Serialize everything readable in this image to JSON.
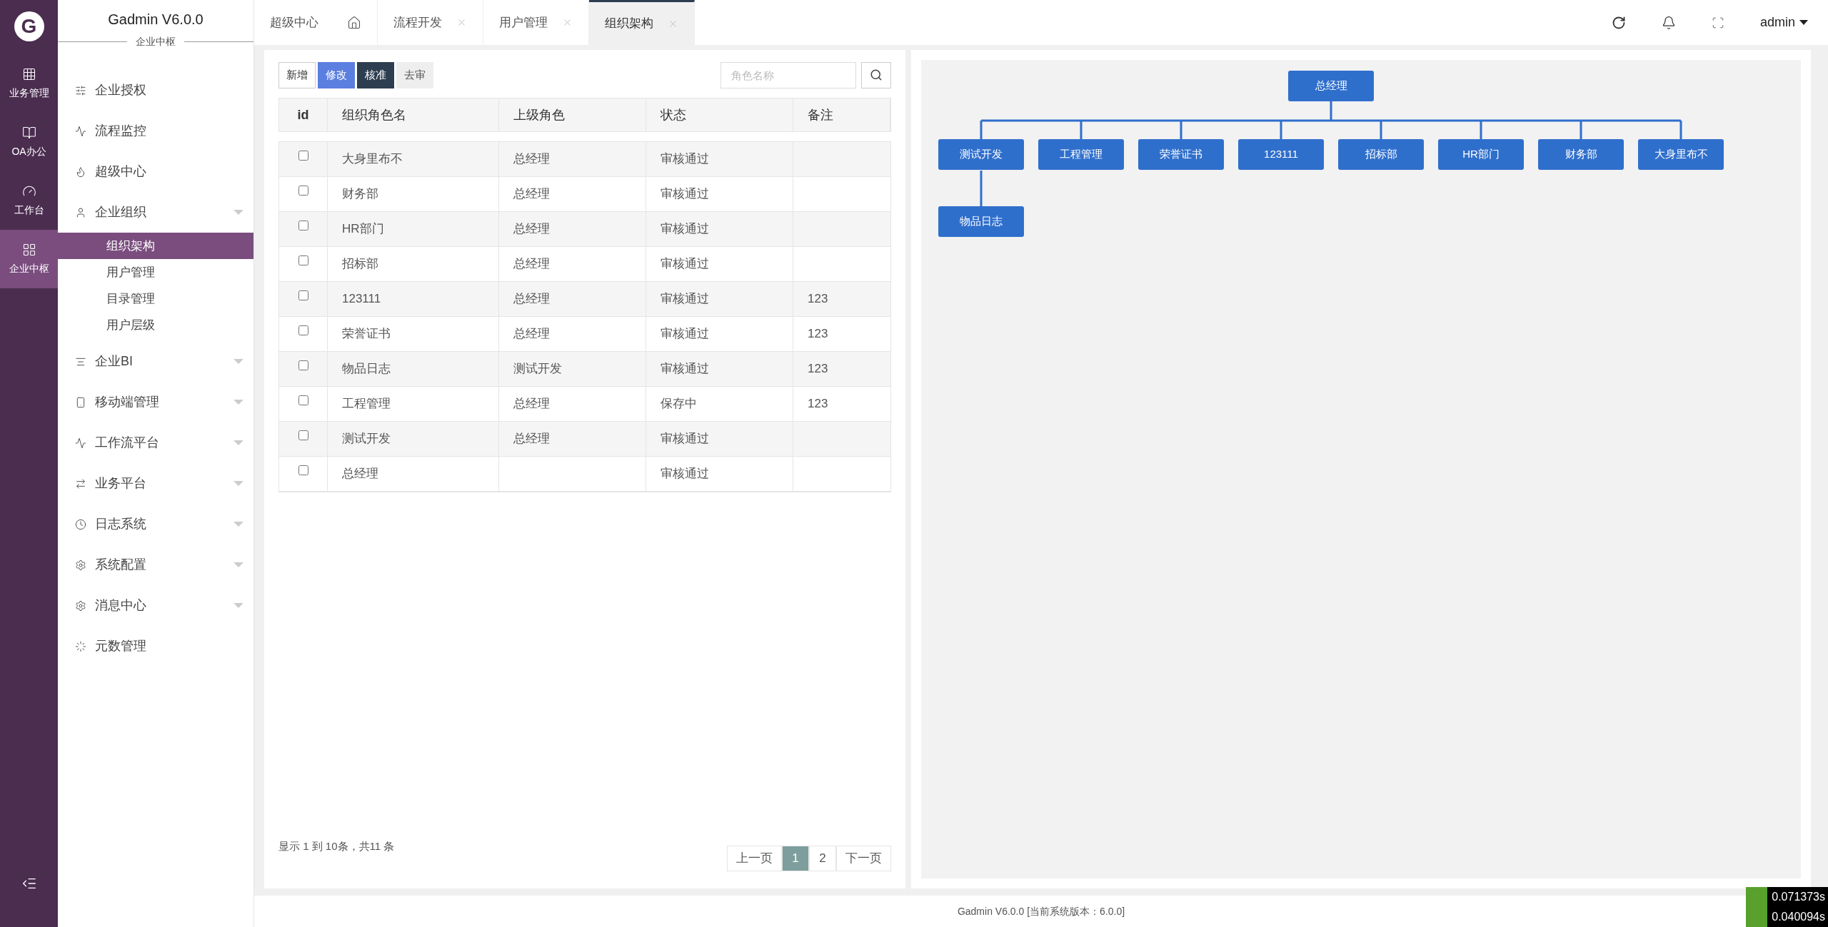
{
  "rail": {
    "logo": "G",
    "items": [
      {
        "label": "业务管理",
        "selected": false
      },
      {
        "label": "OA办公",
        "selected": false
      },
      {
        "label": "工作台",
        "selected": false
      },
      {
        "label": "企业中枢",
        "selected": true
      }
    ]
  },
  "sidebar": {
    "title": "Gadmin V6.0.0",
    "subtitle": "企业中枢",
    "items": [
      {
        "label": "企业授权",
        "kind": "link"
      },
      {
        "label": "流程监控",
        "kind": "link"
      },
      {
        "label": "超级中心",
        "kind": "link"
      },
      {
        "label": "企业组织",
        "kind": "group",
        "children": [
          {
            "label": "组织架构",
            "selected": true
          },
          {
            "label": "用户管理",
            "selected": false
          },
          {
            "label": "目录管理",
            "selected": false
          },
          {
            "label": "用户层级",
            "selected": false
          }
        ]
      },
      {
        "label": "企业BI",
        "kind": "group"
      },
      {
        "label": "移动端管理",
        "kind": "group"
      },
      {
        "label": "工作流平台",
        "kind": "group"
      },
      {
        "label": "业务平台",
        "kind": "group"
      },
      {
        "label": "日志系统",
        "kind": "group"
      },
      {
        "label": "系统配置",
        "kind": "group"
      },
      {
        "label": "消息中心",
        "kind": "group"
      },
      {
        "label": "元数管理",
        "kind": "link"
      }
    ]
  },
  "tabs": [
    {
      "label": "超级中心",
      "kind": "home",
      "selected": false
    },
    {
      "label": "流程开发",
      "kind": "closable",
      "selected": false
    },
    {
      "label": "用户管理",
      "kind": "closable",
      "selected": false
    },
    {
      "label": "组织架构",
      "kind": "closable",
      "selected": true
    }
  ],
  "header": {
    "user": "admin"
  },
  "toolbar": {
    "buttons": [
      {
        "label": "新增",
        "kind": "default"
      },
      {
        "label": "修改",
        "kind": "primary"
      },
      {
        "label": "核准",
        "kind": "dark"
      },
      {
        "label": "去审",
        "kind": "light"
      }
    ],
    "search": {
      "placeholder": "角色名称"
    }
  },
  "table": {
    "columns": [
      "id",
      "组织角色名",
      "上级角色",
      "状态",
      "备注"
    ],
    "rows": [
      {
        "checked": false,
        "name": "大身里布不",
        "parent": "总经理",
        "status": "审核通过"
      },
      {
        "checked": false,
        "name": "财务部",
        "parent": "总经理",
        "status": "审核通过"
      },
      {
        "checked": false,
        "name": "HR部门",
        "parent": "总经理",
        "status": "审核通过"
      },
      {
        "checked": false,
        "name": "招标部",
        "parent": "总经理",
        "status": "审核通过"
      },
      {
        "checked": false,
        "name": "123111",
        "parent": "总经理",
        "status": "审核通过",
        "note": "123"
      },
      {
        "checked": false,
        "name": "荣誉证书",
        "parent": "总经理",
        "status": "审核通过",
        "note": "123"
      },
      {
        "checked": false,
        "name": "物品日志",
        "parent": "测试开发",
        "status": "审核通过",
        "note": "123"
      },
      {
        "checked": false,
        "name": "工程管理",
        "parent": "总经理",
        "status": "保存中",
        "note": "123"
      },
      {
        "checked": false,
        "name": "测试开发",
        "parent": "总经理",
        "status": "审核通过"
      },
      {
        "checked": false,
        "name": "总经理",
        "status": "审核通过"
      }
    ]
  },
  "pagination": {
    "summary": "显示 1 到 10条，共11 条",
    "prev": "上一页",
    "pages": [
      {
        "label": "1",
        "selected": true
      },
      {
        "label": "2",
        "selected": false
      }
    ],
    "next": "下一页"
  },
  "org_chart": {
    "root": {
      "label": "总经理",
      "children": [
        {
          "label": "测试开发",
          "children": [
            {
              "label": "物品日志"
            }
          ]
        },
        {
          "label": "工程管理"
        },
        {
          "label": "荣誉证书"
        },
        {
          "label": "123111"
        },
        {
          "label": "招标部"
        },
        {
          "label": "HR部门"
        },
        {
          "label": "财务部"
        },
        {
          "label": "大身里布不"
        }
      ]
    }
  },
  "footer": "Gadmin V6.0.0 [当前系统版本：6.0.0]",
  "debug_timers": [
    "0.071373s",
    "0.040094s"
  ]
}
